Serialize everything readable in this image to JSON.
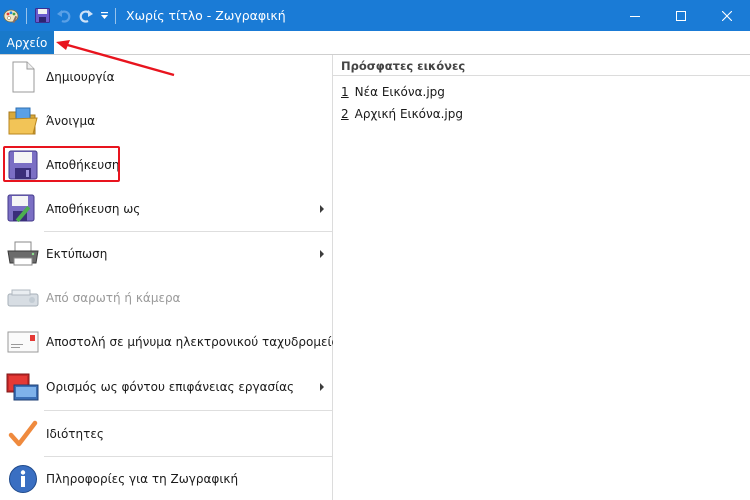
{
  "titlebar": {
    "title": "Χωρίς τίτλο - Ζωγραφική",
    "bg": "#1a7bd6",
    "controls": [
      "minimize-icon",
      "maximize-icon",
      "close-icon"
    ]
  },
  "file_tab": {
    "label": "Αρχείο",
    "bg": "#1979ca"
  },
  "menu": {
    "items": [
      {
        "label": "Δημιουργία",
        "icon": "new-document-icon",
        "submenu": false
      },
      {
        "label": "Άνοιγμα",
        "icon": "open-folder-icon",
        "submenu": false
      },
      {
        "label": "Αποθήκευση",
        "icon": "save-icon",
        "submenu": false,
        "highlighted": true
      },
      {
        "label": "Αποθήκευση ως",
        "icon": "save-as-icon",
        "submenu": true
      },
      {
        "label": "Εκτύπωση",
        "icon": "printer-icon",
        "submenu": true
      },
      {
        "label": "Από σαρωτή ή κάμερα",
        "icon": "scanner-icon",
        "submenu": false,
        "disabled": true
      },
      {
        "label": "Αποστολή σε μήνυμα ηλεκτρονικού ταχυδρομείου",
        "icon": "email-icon",
        "submenu": false
      },
      {
        "label": "Ορισμός ως φόντου επιφάνειας εργασίας",
        "icon": "desktop-background-icon",
        "submenu": true
      },
      {
        "label": "Ιδιότητες",
        "icon": "checkmark-icon",
        "submenu": false
      },
      {
        "label": "Πληροφορίες για τη Ζωγραφική",
        "icon": "info-icon",
        "submenu": false
      }
    ]
  },
  "recent": {
    "heading": "Πρόσφατες εικόνες",
    "items": [
      {
        "num": "1",
        "name": "Νέα Εικόνα.jpg"
      },
      {
        "num": "2",
        "name": "Αρχική Εικόνα.jpg"
      }
    ]
  },
  "annotation": {
    "color": "#e8141e"
  }
}
